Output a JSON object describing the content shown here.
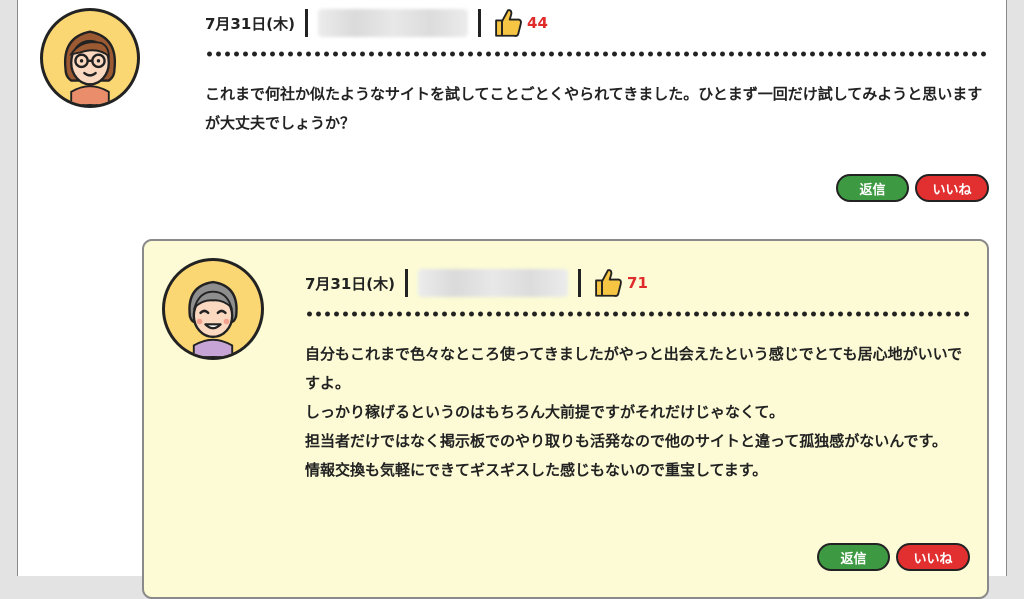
{
  "post": {
    "date": "7月31日(木)",
    "like_count": "44",
    "text": "これまで何社か似たようなサイトを試してことごとくやられてきました。ひとまず一回だけ試してみようと思いますが大丈夫でしょうか？",
    "reply_button": "返信",
    "like_button": "いいね"
  },
  "reply": {
    "date": "7月31日(木)",
    "like_count": "71",
    "text": "自分もこれまで色々なところ使ってきましたがやっと出会えたという感じでとても居心地がいいですよ。\nしっかり稼げるというのはもちろん大前提ですがそれだけじゃなくて。\n担当者だけではなく掲示板でのやり取りも活発なので他のサイトと違って孤独感がないんです。\n情報交換も気軽にできてギスギスした感じもないので重宝してます。",
    "reply_button": "返信",
    "like_button": "いいね"
  },
  "colors": {
    "avatar_bg": "#fbd774",
    "like_count": "#e02b2b",
    "reply_btn": "#3e9a42",
    "like_btn": "#e23030",
    "reply_card_bg": "#fcfbd6"
  },
  "icons": [
    "woman-glasses-avatar-icon",
    "elderly-avatar-icon",
    "thumbs-up-icon"
  ]
}
